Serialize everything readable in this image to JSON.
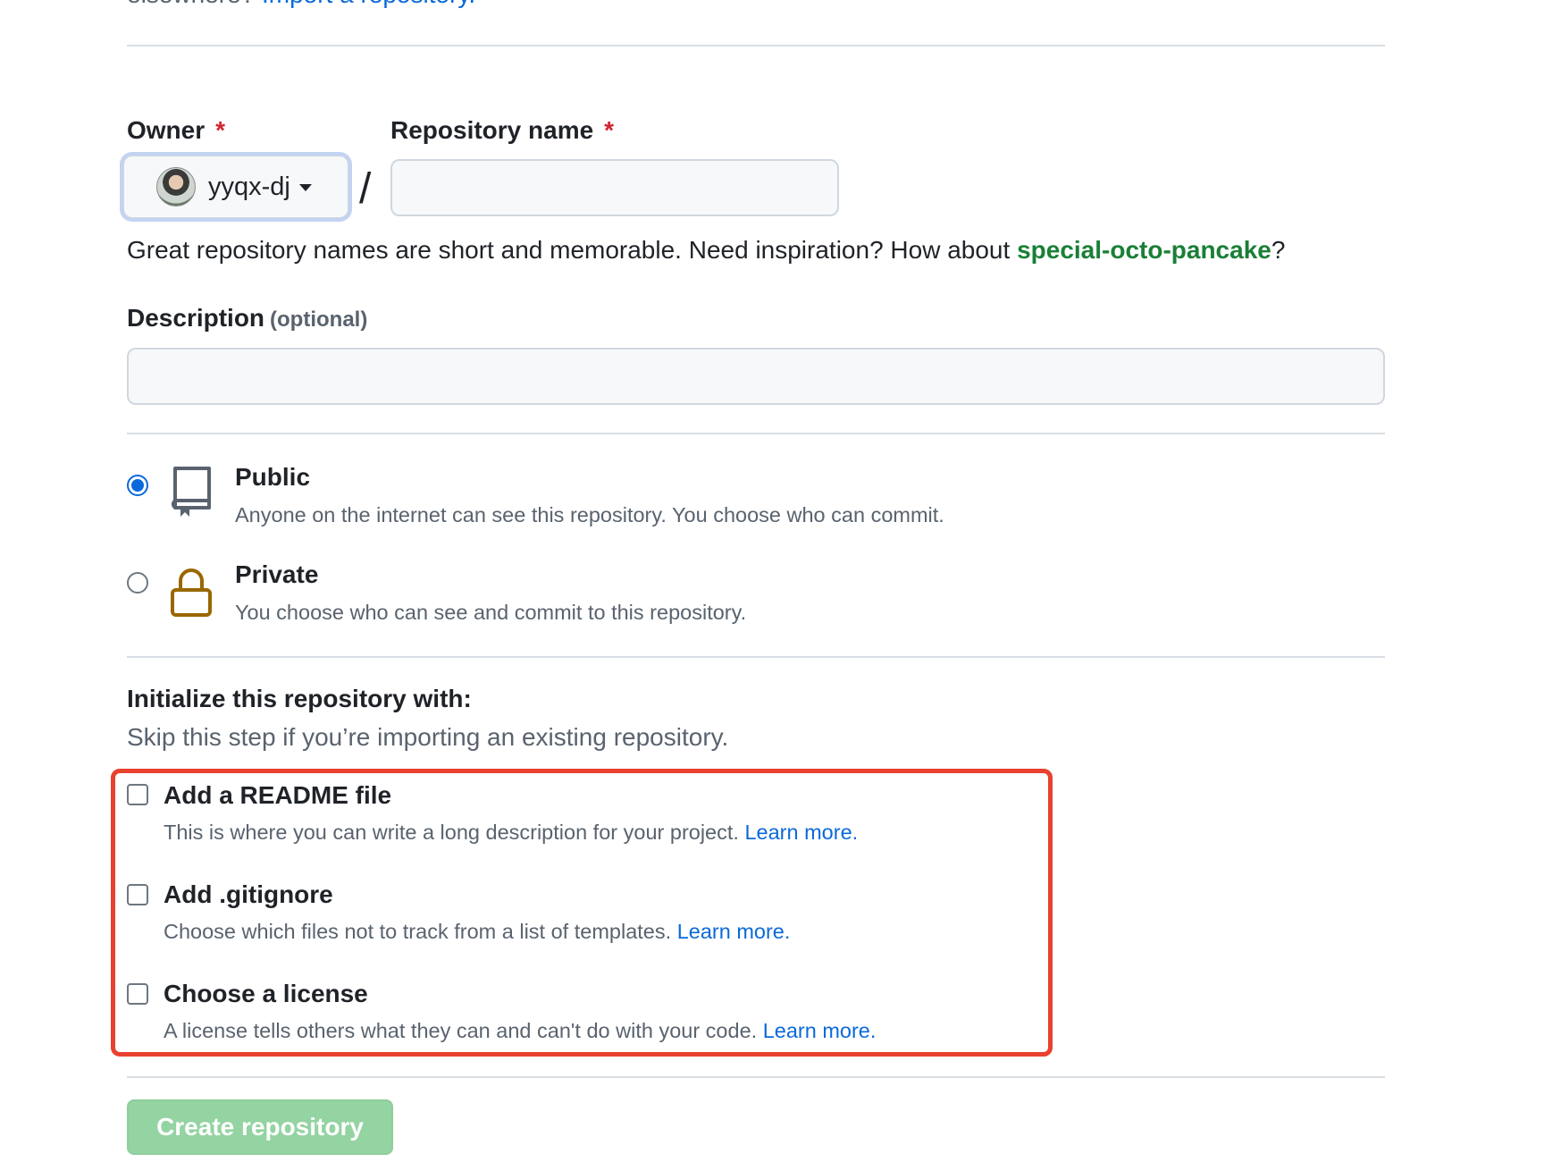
{
  "top": {
    "prefix": "elsewhere?",
    "link": "Import a repository."
  },
  "owner": {
    "label": "Owner",
    "required_mark": "*",
    "selected": "yyqx-dj"
  },
  "separator": "/",
  "repo_name": {
    "label": "Repository name",
    "required_mark": "*",
    "value": "",
    "placeholder": ""
  },
  "hint": {
    "text": "Great repository names are short and memorable. Need inspiration? How about ",
    "suggestion": "special-octo-pancake",
    "suffix": "?"
  },
  "description": {
    "label": "Description",
    "optional": "(optional)",
    "value": "",
    "placeholder": ""
  },
  "visibility": {
    "selected": "public",
    "options": [
      {
        "title": "Public",
        "desc": "Anyone on the internet can see this repository. You choose who can commit."
      },
      {
        "title": "Private",
        "desc": "You choose who can see and commit to this repository."
      }
    ]
  },
  "init": {
    "title": "Initialize this repository with:",
    "subtitle": "Skip this step if you’re importing an existing repository.",
    "items": [
      {
        "title": "Add a README file",
        "desc": "This is where you can write a long description for your project. ",
        "link": "Learn more.",
        "checked": false
      },
      {
        "title": "Add .gitignore",
        "desc": "Choose which files not to track from a list of templates. ",
        "link": "Learn more.",
        "checked": false
      },
      {
        "title": "Choose a license",
        "desc": "A license tells others what they can and can't do with your code. ",
        "link": "Learn more.",
        "checked": false
      }
    ]
  },
  "submit": {
    "label": "Create repository"
  },
  "colors": {
    "accent": "#0969da",
    "required": "#d1242f",
    "suggestion": "#1a7f37",
    "highlight_box": "#e8412f",
    "create_button": "#94d3a2",
    "lock_icon": "#9a6700"
  }
}
